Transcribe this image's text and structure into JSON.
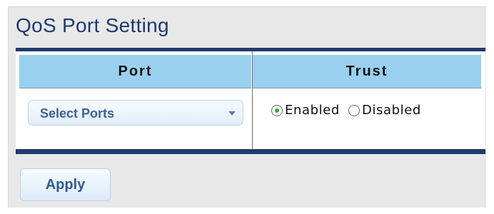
{
  "title": "QoS Port Setting",
  "table": {
    "headers": {
      "port": "Port",
      "trust": "Trust"
    },
    "row": {
      "port_select": {
        "value": "Select Ports",
        "icon": "chevron-down-icon"
      },
      "trust_options": [
        {
          "label": "Enabled",
          "checked": true
        },
        {
          "label": "Disabled",
          "checked": false
        }
      ]
    }
  },
  "actions": {
    "apply_label": "Apply"
  },
  "colors": {
    "title": "#1d3a6e",
    "header_bg": "#99d0f0",
    "table_border": "#1f3a6c",
    "button_text": "#2f5b91",
    "radio_checked": "#2fae2f"
  }
}
